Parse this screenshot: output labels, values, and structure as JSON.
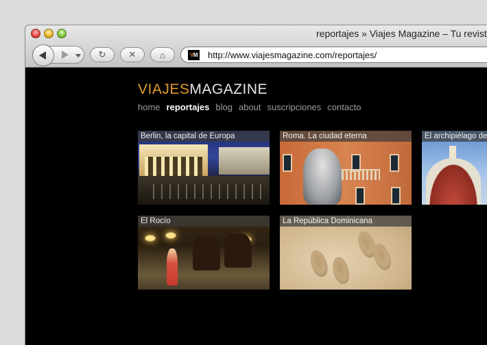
{
  "window": {
    "title": "reportajes » Viajes Magazine – Tu revist"
  },
  "toolbar": {
    "back_icon": "back-arrow",
    "forward_icon": "forward-arrow",
    "reload_icon": "↻",
    "stop_icon": "✕",
    "home_icon": "⌂",
    "favicon": {
      "v": "V",
      "m": "M"
    },
    "url": "http://www.viajesmagazine.com/reportajes/"
  },
  "site": {
    "logo": {
      "part1": "VIAJES",
      "part2": "MAGAZINE"
    },
    "nav": [
      {
        "label": "home",
        "active": false
      },
      {
        "label": "reportajes",
        "active": true
      },
      {
        "label": "blog",
        "active": false
      },
      {
        "label": "about",
        "active": false
      },
      {
        "label": "suscripciones",
        "active": false
      },
      {
        "label": "contacto",
        "active": false
      }
    ],
    "articles": [
      {
        "caption": "Berlin, la capital de Europa"
      },
      {
        "caption": "Roma. La ciudad eterna"
      },
      {
        "caption": "El archipiélago de"
      },
      {
        "caption": "El Rocío"
      },
      {
        "caption": "La República Dominicana"
      }
    ]
  },
  "colors": {
    "logo_accent": "#e29a30",
    "nav_active": "#ffffff",
    "nav_inactive": "#9c9c9c",
    "page_bg": "#000000"
  }
}
